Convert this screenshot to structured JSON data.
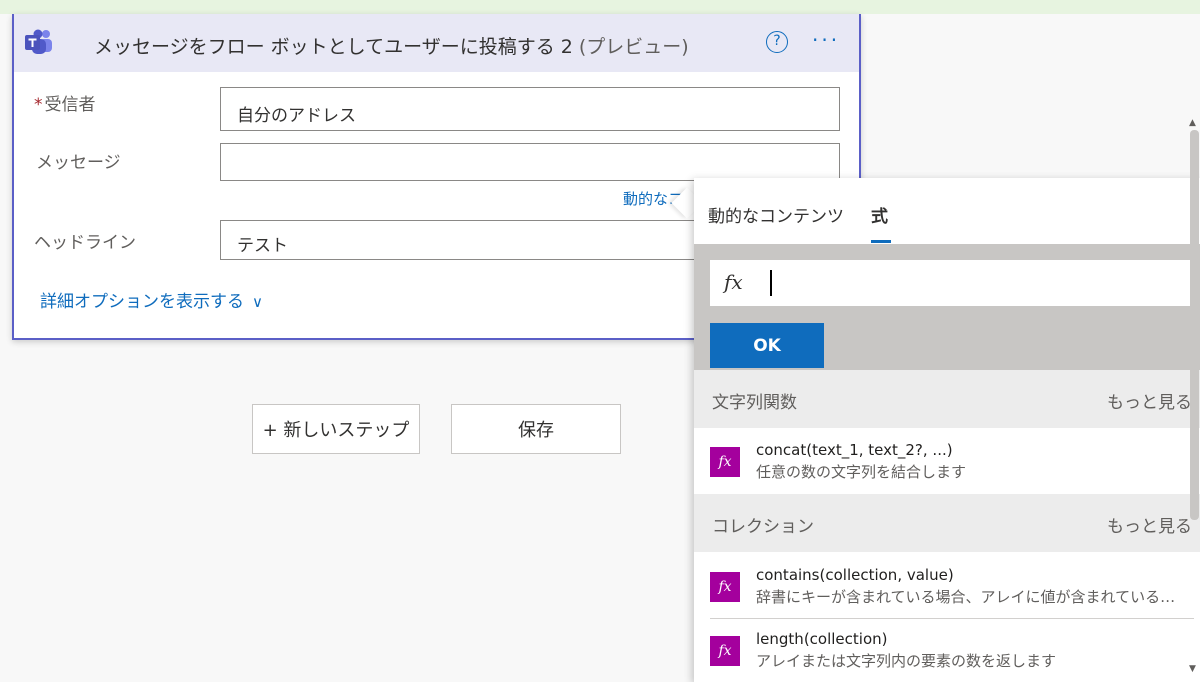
{
  "card": {
    "title": "メッセージをフロー ボットとしてユーザーに投稿する 2",
    "title_suffix": "(プレビュー)",
    "help_icon": "?",
    "more_icon": "···",
    "fields": {
      "recipient": {
        "required_mark": "*",
        "label": "受信者",
        "value": "自分のアドレス"
      },
      "message": {
        "label": "メッセージ",
        "value": ""
      },
      "headline": {
        "label": "ヘッドライン",
        "value": "テスト"
      }
    },
    "dynamic_link": "動的なコ",
    "advanced_link": "詳細オプションを表示する",
    "advanced_chevron": "∨"
  },
  "buttons": {
    "new_step": "+ 新しいステップ",
    "save": "保存"
  },
  "flyout": {
    "tabs": [
      "動的なコンテンツ",
      "式"
    ],
    "active_tab_index": 1,
    "fx_label": "fx",
    "ok_label": "OK",
    "sections": [
      {
        "name": "文字列関数",
        "more": "もっと見る",
        "items": [
          {
            "icon": "fx",
            "name": "concat(text_1, text_2?, ...)",
            "description": "任意の数の文字列を結合します"
          }
        ]
      },
      {
        "name": "コレクション",
        "more": "もっと見る",
        "items": [
          {
            "icon": "fx",
            "name": "contains(collection, value)",
            "description": "辞書にキーが含まれている場合、アレイに値が含まれている場合"
          },
          {
            "icon": "fx",
            "name": "length(collection)",
            "description": "アレイまたは文字列内の要素の数を返します"
          }
        ]
      }
    ]
  },
  "colors": {
    "accent": "#0f6cbd",
    "card_border": "#5b5fc7",
    "header_bg": "#e8e8f5",
    "function_icon": "#a4009d",
    "required": "#a4262c"
  }
}
